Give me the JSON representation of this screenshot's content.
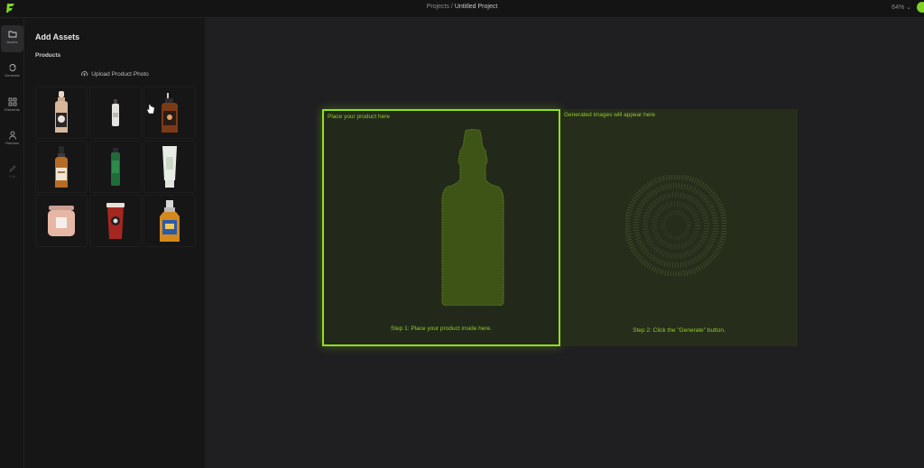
{
  "topbar": {
    "breadcrumb_root": "Projects",
    "breadcrumb_sep": " / ",
    "breadcrumb_current": "Untitled Project",
    "zoom": "64% ⌄"
  },
  "rail": [
    {
      "label": "Assets",
      "icon": "folder-icon"
    },
    {
      "label": "Generate",
      "icon": "refresh-icon"
    },
    {
      "label": "Elements",
      "icon": "elements-icon"
    },
    {
      "label": "Humans",
      "icon": "person-icon"
    },
    {
      "label": "Edit",
      "icon": "edit-icon"
    }
  ],
  "panel": {
    "title": "Add Assets",
    "section": "Products",
    "upload_label": "Upload Product Photo"
  },
  "products": [
    "serum-dropper-bottle",
    "slim-white-bottle",
    "amber-spray-bottle",
    "amber-dropper-bottle",
    "green-tall-bottle",
    "white-cream-tube",
    "pink-candle-jar",
    "red-coffee-cup",
    "perfume-bottle"
  ],
  "canvas": {
    "drop_label": "Place your product here",
    "drop_step": "Step 1: Place your product inside here.",
    "gen_label": "Generated images will appear here",
    "gen_step": "Step 2: Click the \"Generate\" button."
  },
  "colors": {
    "accent": "#8fe01e",
    "background": "#1f1f21",
    "panel": "#161616"
  }
}
